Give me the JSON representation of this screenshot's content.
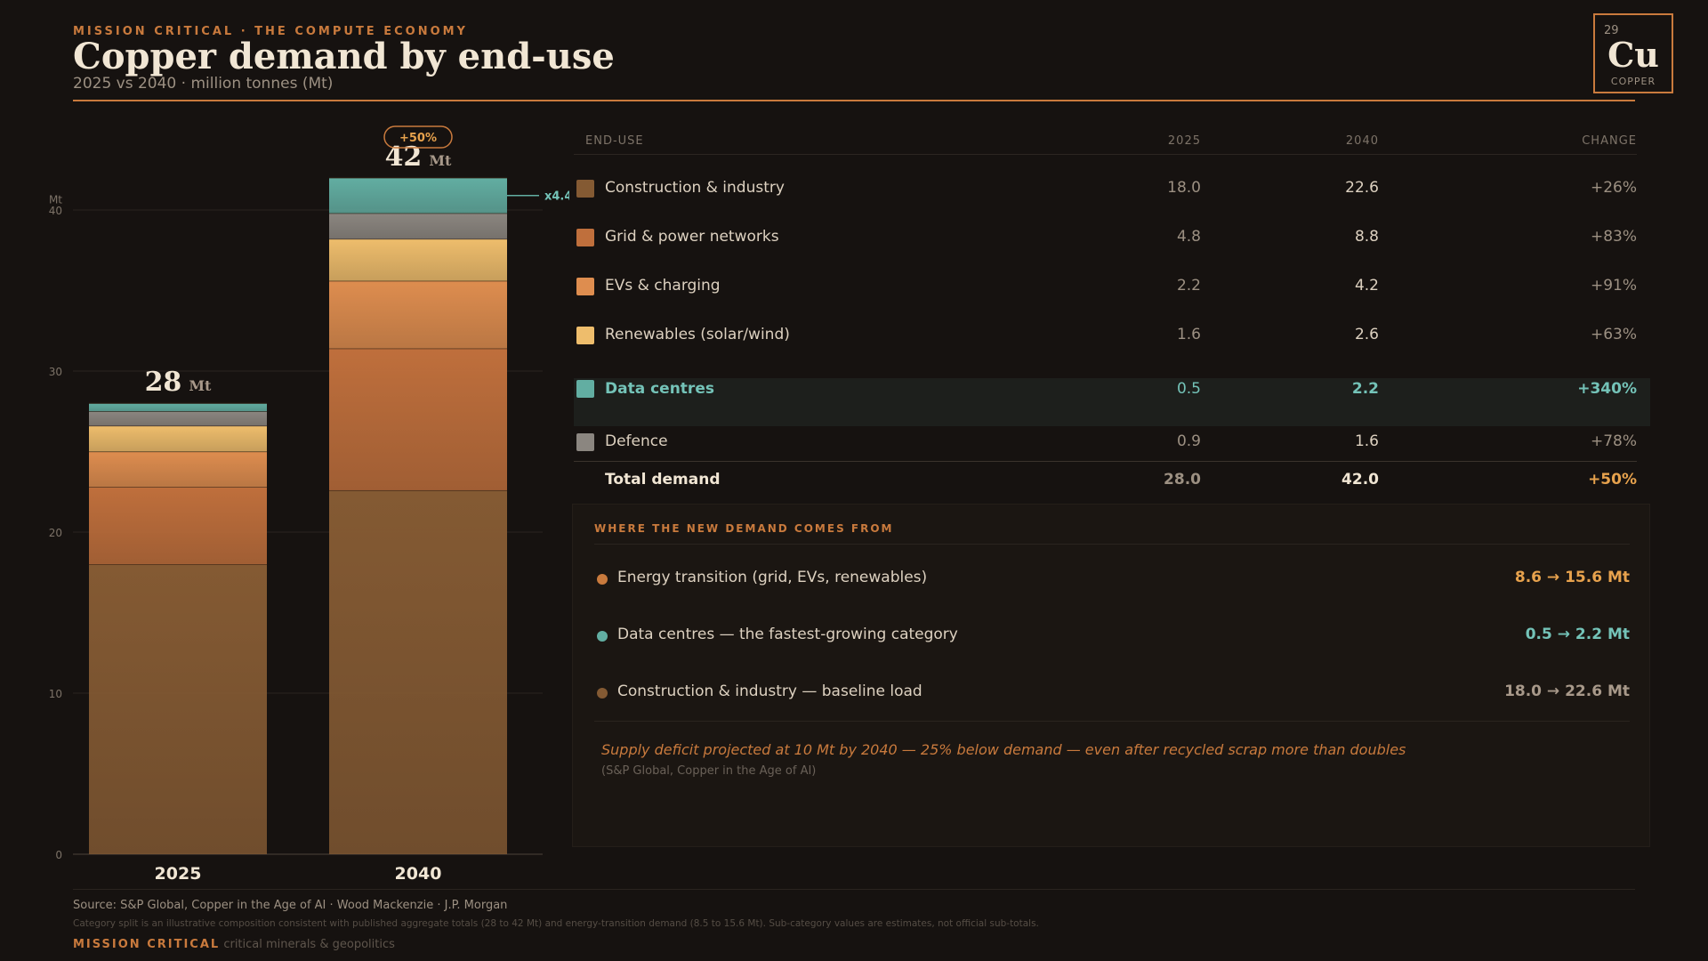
{
  "header": {
    "eyebrow": "MISSION CRITICAL · THE COMPUTE ECONOMY",
    "title": "Copper demand by end-use",
    "subtitle": "2025 vs 2040 · million tonnes (Mt)"
  },
  "badge": {
    "number": "29",
    "symbol": "Cu",
    "name": "COPPER"
  },
  "chart_data": {
    "type": "bar",
    "stacked": true,
    "categories": [
      "2025",
      "2040"
    ],
    "series": [
      {
        "name": "Construction & industry",
        "color": "#845a33",
        "values": [
          18.0,
          22.6
        ]
      },
      {
        "name": "Grid & power networks",
        "color": "#bf6f3c",
        "values": [
          4.8,
          8.8
        ]
      },
      {
        "name": "EVs & charging",
        "color": "#de8d4f",
        "values": [
          2.2,
          4.2
        ]
      },
      {
        "name": "Renewables (solar/wind)",
        "color": "#eebd6c",
        "values": [
          1.6,
          2.6
        ]
      },
      {
        "name": "Defence",
        "color": "#8b8680",
        "values": [
          0.9,
          1.6
        ]
      },
      {
        "name": "Data centres",
        "color": "#62aea2",
        "values": [
          0.5,
          2.2
        ]
      }
    ],
    "totals": [
      28,
      42
    ],
    "total_unit": "Mt",
    "growth_badge": "+50%",
    "datacentre_multiplier": "x4.4",
    "ylabel": "Mt",
    "ylim": [
      0,
      42
    ],
    "yticks": [
      0,
      10,
      20,
      30,
      40
    ],
    "grid": true
  },
  "table": {
    "headers": {
      "end_use": "END-USE",
      "y2025": "2025",
      "y2040": "2040",
      "change": "CHANGE"
    },
    "rows": [
      {
        "label": "Construction & industry",
        "v2025": "18.0",
        "v2040": "22.6",
        "change": "+26%",
        "color": "#845a33"
      },
      {
        "label": "Grid & power networks",
        "v2025": "4.8",
        "v2040": "8.8",
        "change": "+83%",
        "color": "#bf6f3c"
      },
      {
        "label": "EVs & charging",
        "v2025": "2.2",
        "v2040": "4.2",
        "change": "+91%",
        "color": "#de8d4f"
      },
      {
        "label": "Renewables (solar/wind)",
        "v2025": "1.6",
        "v2040": "2.6",
        "change": "+63%",
        "color": "#eebd6c"
      },
      {
        "label": "Data centres",
        "v2025": "0.5",
        "v2040": "2.2",
        "change": "+340%",
        "color": "#62aea2"
      },
      {
        "label": "Defence",
        "v2025": "0.9",
        "v2040": "1.6",
        "change": "+78%",
        "color": "#8b8680"
      }
    ],
    "total": {
      "label": "Total demand",
      "v2025": "28.0",
      "v2040": "42.0",
      "change": "+50%"
    }
  },
  "panel": {
    "heading": "WHERE THE NEW DEMAND COMES FROM",
    "items": [
      {
        "label": "Energy transition (grid, EVs, renewables)",
        "value": "8.6 → 15.6 Mt",
        "color": "#c97a3d",
        "value_color": "#e7a24d"
      },
      {
        "label": "Data centres — the fastest-growing category",
        "value": "0.5 → 2.2 Mt",
        "color": "#62aea2",
        "value_color": "#74c3b8"
      },
      {
        "label": "Construction & industry — baseline load",
        "value": "18.0 → 22.6 Mt",
        "color": "#845a33",
        "value_color": "#a8998a"
      }
    ],
    "note": "Supply deficit projected at 10 Mt by 2040 — 25% below demand — even after recycled scrap more than doubles",
    "note_source": "(S&P Global, Copper in the Age of AI)"
  },
  "footer": {
    "source": "Source: S&P Global, Copper in the Age of AI · Wood Mackenzie · J.P. Morgan",
    "disclaimer": "Category split is an illustrative composition consistent with published aggregate totals (28 to 42 Mt) and energy-transition demand (8.5 to 15.6 Mt). Sub-category values are estimates, not official sub-totals.",
    "brand": "MISSION CRITICAL",
    "brand_tagline": "critical minerals & geopolitics"
  }
}
